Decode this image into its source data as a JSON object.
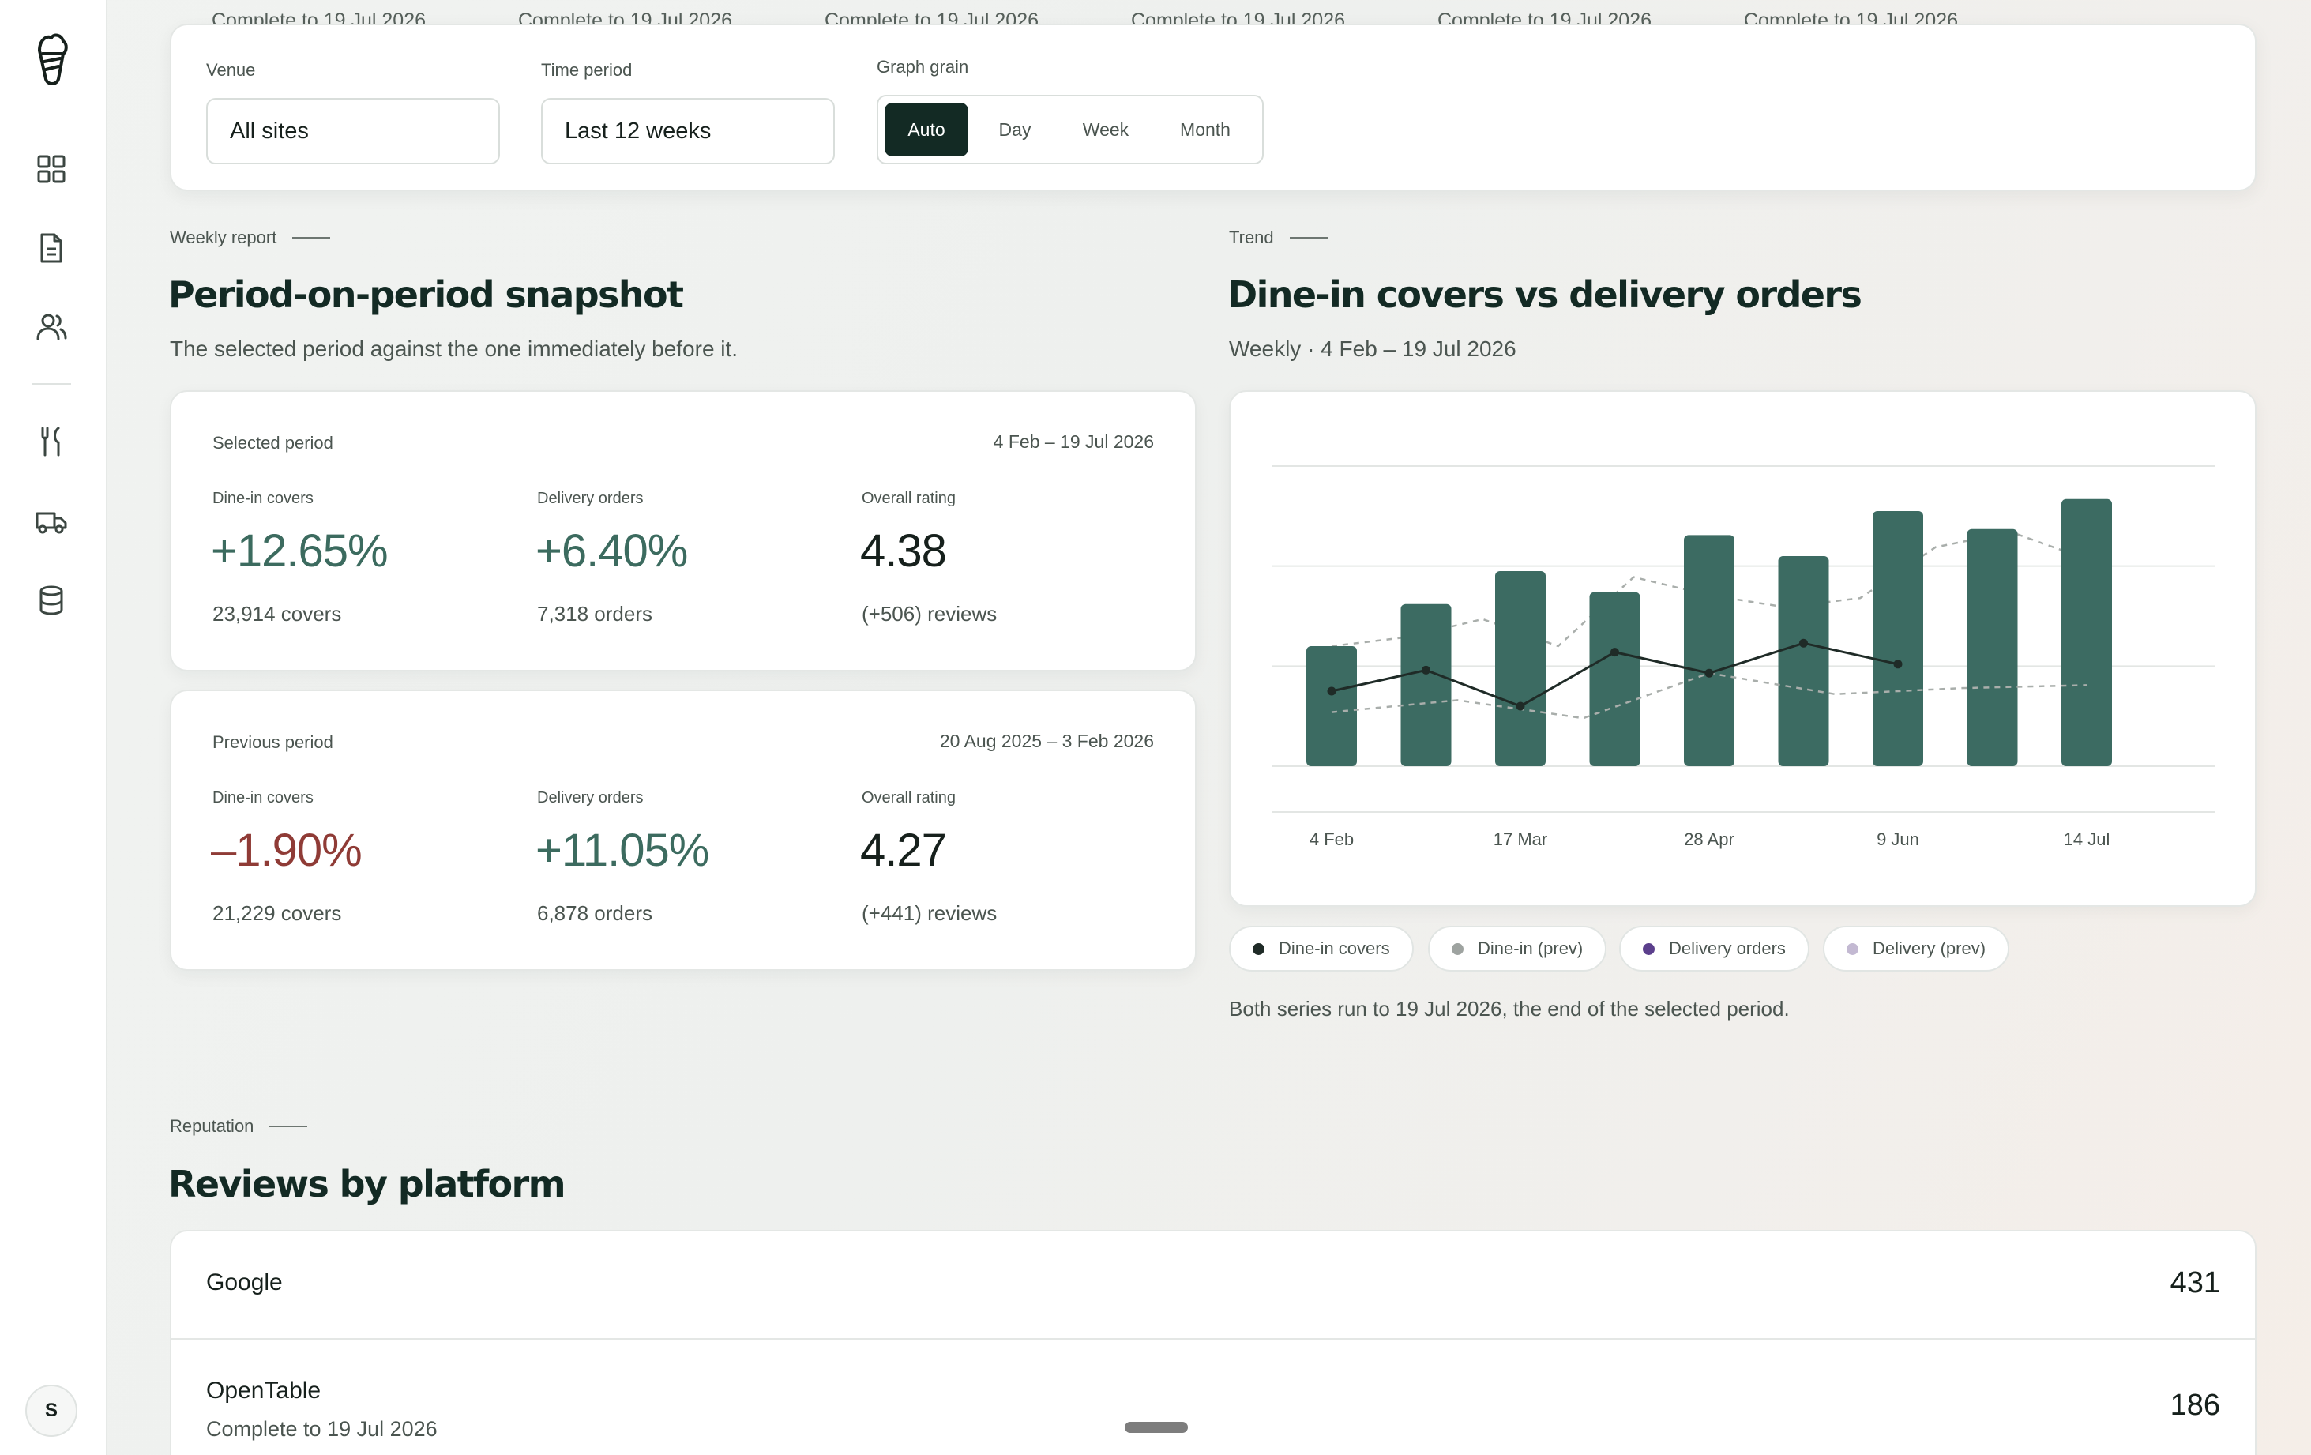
{
  "sidebar": {
    "icons": [
      "logo-icon",
      "dashboard-icon",
      "report-icon",
      "people-icon",
      "cutlery-icon",
      "delivery-icon",
      "database-icon"
    ],
    "avatar_initial": "S"
  },
  "ghost_row": [
    "Complete to 19 Jul 2026",
    "Complete to 19 Jul 2026",
    "Complete to 19 Jul 2026",
    "Complete to 19 Jul 2026",
    "Complete to 19 Jul 2026",
    "Complete to 19 Jul 2026"
  ],
  "filters": {
    "venue_label": "Venue",
    "venue_value": "All sites",
    "period_label": "Time period",
    "period_value": "Last 12 weeks",
    "grain_label": "Graph grain",
    "grain_options": [
      "Auto",
      "Day",
      "Week",
      "Month"
    ],
    "grain_selected": "Auto"
  },
  "snapshot": {
    "eyebrow": "Weekly report",
    "title": "Period-on-period snapshot",
    "subtitle": "The selected period against the one immediately before it.",
    "selected": {
      "title": "Selected period",
      "range": "4 Feb – 19 Jul 2026",
      "metrics": [
        {
          "label": "Dine-in covers",
          "value": "+12.65%",
          "sub": "23,914 covers"
        },
        {
          "label": "Delivery orders",
          "value": "+6.40%",
          "sub": "7,318 orders"
        },
        {
          "label": "Overall rating",
          "value": "4.38",
          "sub": "(+506) reviews"
        }
      ]
    },
    "previous": {
      "title": "Previous period",
      "range": "20 Aug 2025 – 3 Feb 2026",
      "metrics": [
        {
          "label": "Dine-in covers",
          "value": "–1.90%",
          "sub": "21,229 covers"
        },
        {
          "label": "Delivery orders",
          "value": "+11.05%",
          "sub": "6,878 orders"
        },
        {
          "label": "Overall rating",
          "value": "4.27",
          "sub": "(+441) reviews"
        }
      ]
    }
  },
  "trend": {
    "eyebrow": "Trend",
    "title": "Dine-in covers vs delivery orders",
    "subtitle": "Weekly · 4 Feb – 19 Jul 2026",
    "legend": [
      {
        "label": "Dine-in covers",
        "color": "#1f2b27"
      },
      {
        "label": "Dine-in (prev)",
        "color": "#9ea3a0"
      },
      {
        "label": "Delivery orders",
        "color": "#5b3f8c"
      },
      {
        "label": "Delivery (prev)",
        "color": "#c3b9d2"
      }
    ],
    "note": "Both series run to 19 Jul 2026, the end of the selected period."
  },
  "chart_data": {
    "type": "bar",
    "tick_labels": [
      "4 Feb",
      "17 Mar",
      "28 Apr",
      "9 Jun",
      "14 Jul"
    ],
    "tick_positions": [
      0,
      2,
      4,
      6,
      8
    ],
    "ylim": [
      0,
      100
    ],
    "grid": true,
    "colors": {
      "bar": "#3c6b62",
      "line": "#1f2b27",
      "prev": "#a9aeab"
    },
    "series": [
      {
        "values": [
          40,
          54,
          65,
          58,
          77,
          70,
          85,
          79,
          89
        ]
      },
      {
        "values": [
          25,
          32,
          20,
          38,
          31,
          41,
          34
        ]
      },
      {
        "values": [
          40,
          43,
          49,
          40,
          63,
          57,
          53,
          56,
          73,
          78,
          69
        ]
      },
      {
        "values": [
          18,
          22,
          16,
          31,
          24,
          26,
          27
        ]
      }
    ]
  },
  "reputation": {
    "eyebrow": "Reputation",
    "title": "Reviews by platform",
    "platforms": [
      {
        "name": "Google",
        "count": "431",
        "sub": ""
      },
      {
        "name": "OpenTable",
        "count": "186",
        "sub": "Complete to 19 Jul 2026"
      }
    ]
  }
}
